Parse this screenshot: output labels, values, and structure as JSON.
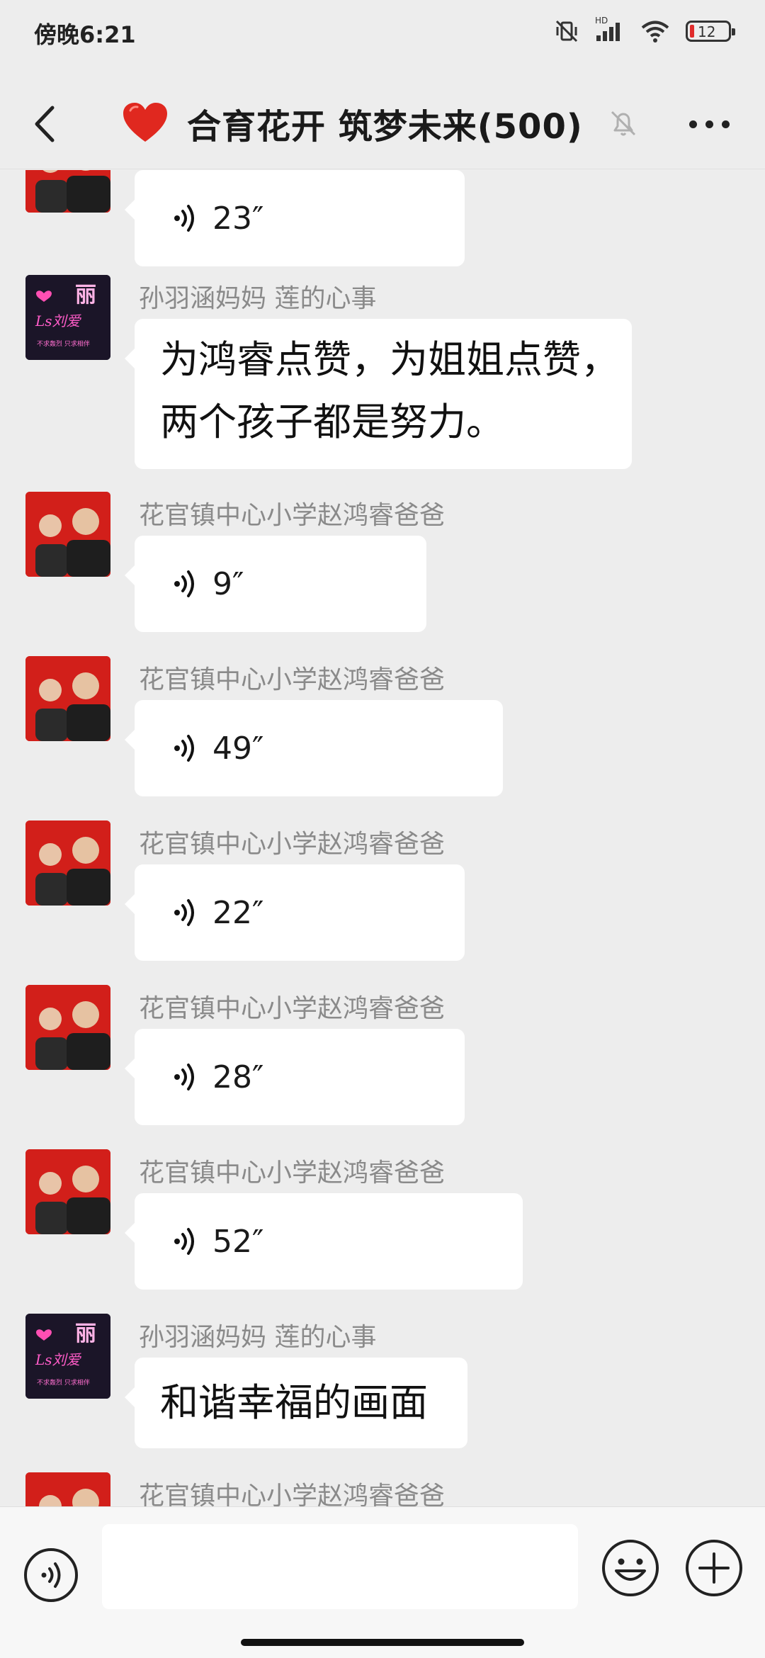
{
  "status_bar": {
    "time": "傍晚6:21",
    "network_label": "HD",
    "battery_level": "12"
  },
  "header": {
    "title": "合育花开 筑梦未来(500)"
  },
  "messages": [
    {
      "type": "voice",
      "sender": "",
      "duration": "23″",
      "avatar": "father-son-photo"
    },
    {
      "type": "text",
      "sender": "孙羽涵妈妈  莲的心事",
      "lines": [
        "为鸿睿点赞，为姐姐点赞，",
        "两个孩子都是努力。"
      ],
      "avatar": "neon-li-art"
    },
    {
      "type": "voice",
      "sender": "花官镇中心小学赵鸿睿爸爸",
      "duration": "9″",
      "avatar": "father-son-photo"
    },
    {
      "type": "voice",
      "sender": "花官镇中心小学赵鸿睿爸爸",
      "duration": "49″",
      "avatar": "father-son-photo"
    },
    {
      "type": "voice",
      "sender": "花官镇中心小学赵鸿睿爸爸",
      "duration": "22″",
      "avatar": "father-son-photo"
    },
    {
      "type": "voice",
      "sender": "花官镇中心小学赵鸿睿爸爸",
      "duration": "28″",
      "avatar": "father-son-photo"
    },
    {
      "type": "voice",
      "sender": "花官镇中心小学赵鸿睿爸爸",
      "duration": "52″",
      "avatar": "father-son-photo"
    },
    {
      "type": "text",
      "sender": "孙羽涵妈妈  莲的心事",
      "lines": [
        "和谐幸福的画面"
      ],
      "avatar": "neon-li-art"
    },
    {
      "type": "partial",
      "sender": "花官镇中心小学赵鸿睿爸爸",
      "avatar": "father-son-photo"
    }
  ],
  "neon_avatar": {
    "glyph": "丽",
    "script": "Ls刘爱",
    "tagline": "不求轰烈 只求相伴"
  },
  "input": {
    "placeholder": ""
  },
  "colors": {
    "background": "#ededed",
    "bubble": "#ffffff",
    "sender_text": "#8a8a8a",
    "heart": "#e0281f"
  }
}
